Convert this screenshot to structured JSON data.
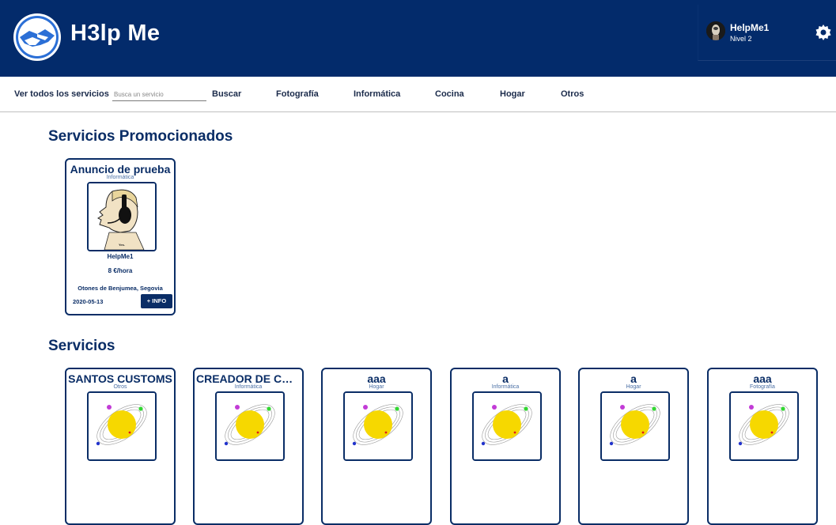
{
  "header": {
    "brand": "H3lp Me",
    "user": {
      "name": "HelpMe1",
      "level": "Nivel 2"
    }
  },
  "nav": {
    "all_services": "Ver todos los servicios",
    "search_placeholder": "Busca un servicio",
    "search_button": "Buscar",
    "categories": [
      "Fotografía",
      "Informática",
      "Cocina",
      "Hogar",
      "Otros"
    ]
  },
  "promoted": {
    "title": "Servicios Promocionados",
    "cards": [
      {
        "title": "Anuncio de prueba",
        "category": "Informática",
        "user": "HelpMe1",
        "price": "8 €/hora",
        "location": "Otones de Benjumea, Segovia",
        "date": "2020-05-13",
        "button": "+ INFO"
      }
    ]
  },
  "services": {
    "title": "Servicios",
    "cards": [
      {
        "title": "SANTOS CUSTOMS",
        "category": "Otros"
      },
      {
        "title": "CREADOR DE CONT…",
        "category": "Informática"
      },
      {
        "title": "aaa",
        "category": "Hogar"
      },
      {
        "title": "a",
        "category": "Informática"
      },
      {
        "title": "a",
        "category": "Hogar"
      },
      {
        "title": "aaa",
        "category": "Fotografía"
      }
    ]
  },
  "colors": {
    "primary": "#032b6b",
    "accent": "#0a2d66"
  },
  "icons": {
    "logo": "handshake-logo-icon",
    "settings": "gear-icon"
  }
}
